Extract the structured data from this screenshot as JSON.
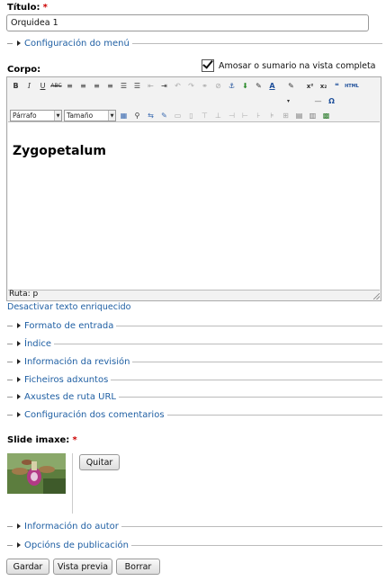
{
  "title": {
    "label": "Título:",
    "required_mark": "*",
    "value": "Orquidea 1"
  },
  "menu_settings": {
    "label": "Configuración do menú"
  },
  "body": {
    "label": "Corpo:",
    "summary_checkbox_label": "Amosar o sumario na vista completa",
    "summary_checked": true,
    "format_select": "Párrafo",
    "size_select": "Tamaño",
    "content_heading": "Zygopetalum",
    "path_status": "Ruta: p",
    "disable_rich_text": "Desactivar texto enriquecido"
  },
  "toolbar": {
    "row1": [
      "B",
      "I",
      "U",
      "ABC",
      "≡",
      "≡",
      "≡",
      "≡",
      "☰",
      "☰",
      "⇤",
      "⇥",
      "↶",
      "↷",
      "⚭",
      "⊘",
      "⚓",
      "⬇",
      "✎",
      "A",
      "✎",
      "x²",
      "x₂",
      "❝",
      "HTML"
    ],
    "row2": [
      "▾",
      "—",
      "Ω"
    ]
  },
  "collapsibles": [
    "Formato de entrada",
    "Índice",
    "Información da revisión",
    "Ficheiros adxuntos",
    "Axustes de ruta URL",
    "Configuración dos comentarios"
  ],
  "slide": {
    "label": "Slide imaxe:",
    "required_mark": "*",
    "remove_button": "Quitar"
  },
  "bottom_collapsibles": [
    "Información do autor",
    "Opcións de publicación"
  ],
  "actions": {
    "save": "Gardar",
    "preview": "Vista previa",
    "delete": "Borrar"
  },
  "colors": {
    "link": "#1f5fa3",
    "required": "#cc0000",
    "border": "#aaaaaa"
  }
}
